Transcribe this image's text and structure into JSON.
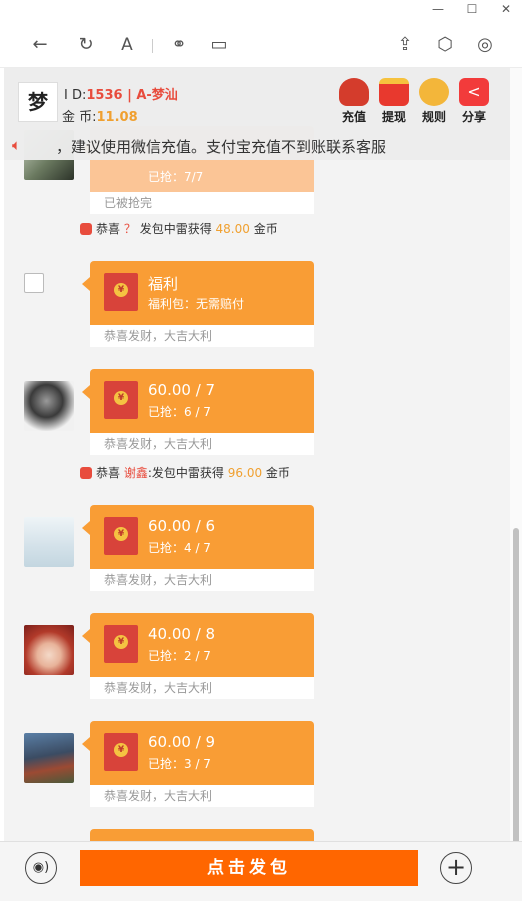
{
  "window": {
    "minimize": "—",
    "maximize": "☐",
    "close": "✕"
  },
  "header": {
    "id_label": "I D:",
    "id_value": "1536 | A-梦汕",
    "coin_label": "金 币:",
    "coin_value": "11.08",
    "logo_text": "梦"
  },
  "actions": [
    {
      "label": "充值"
    },
    {
      "label": "提现"
    },
    {
      "label": "规则"
    },
    {
      "label": "分享"
    }
  ],
  "notice": {
    "text": "，建议使用微信充值。支付宝充值不到账联系客服"
  },
  "messages": [
    {
      "sub": "已抢：7/7",
      "footer": "已被抢完"
    },
    {
      "amount": "福利",
      "sub": "福利包：无需赔付",
      "footer": "恭喜发财，大吉大利"
    },
    {
      "amount": "60.00 / 7",
      "sub": "已抢：6 / 7",
      "footer": "恭喜发财，大吉大利"
    },
    {
      "amount": "60.00 / 6",
      "sub": "已抢：4 / 7",
      "footer": "恭喜发财，大吉大利"
    },
    {
      "amount": "40.00 / 8",
      "sub": "已抢：2 / 7",
      "footer": "恭喜发财，大吉大利"
    },
    {
      "amount": "60.00 / 9",
      "sub": "已抢：3 / 7",
      "footer": "恭喜发财，大吉大利"
    }
  ],
  "system": [
    {
      "prefix": "恭喜",
      "name": "？",
      "middle": "发包中雷获得",
      "amount": "48.00",
      "suffix": "金币"
    },
    {
      "prefix": "恭喜",
      "name": "谢鑫",
      "middle": ":发包中雷获得",
      "amount": "96.00",
      "suffix": "金币"
    }
  ],
  "bottom": {
    "send_label": "点击发包"
  },
  "colors": {
    "accent": "#ff6600",
    "bubble": "#f99d35",
    "envelope": "#d8433a",
    "highlight": "#e84c3d"
  }
}
